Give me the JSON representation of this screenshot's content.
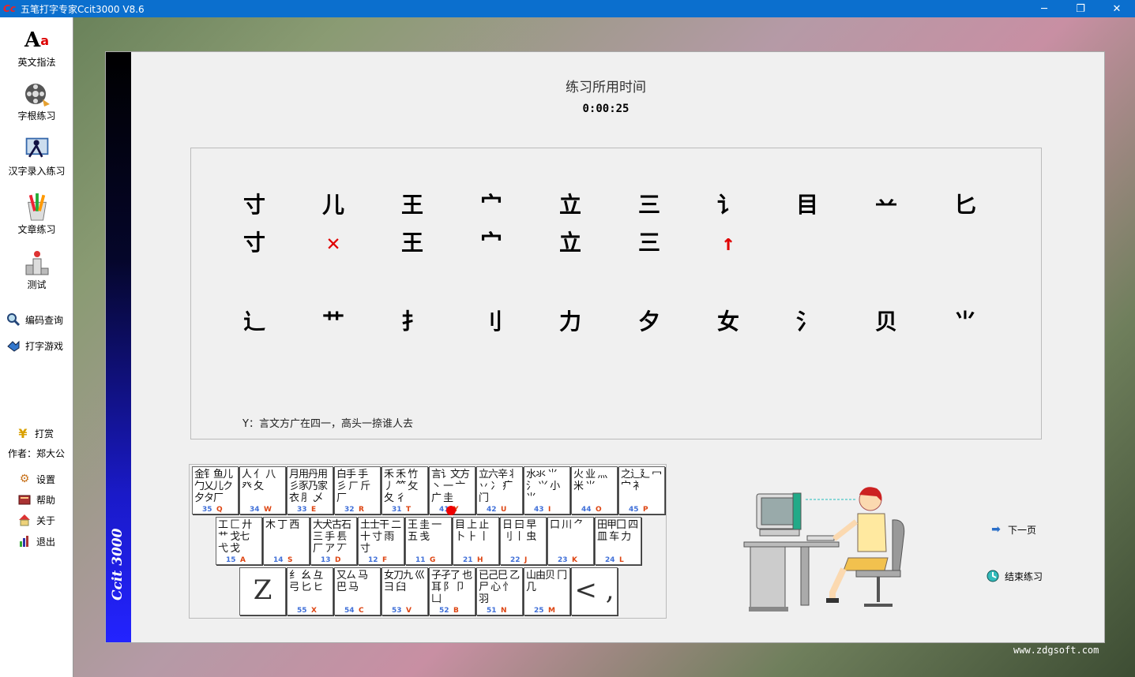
{
  "window": {
    "title": "五笔打字专家Ccit3000 V8.6",
    "logo_text": "Cc",
    "controls": {
      "minimize": "─",
      "restore": "❐",
      "close": "✕"
    }
  },
  "sidebar": {
    "items": [
      {
        "name": "english-fingering",
        "label": "英文指法",
        "icon": "Aa-icon"
      },
      {
        "name": "radical-practice",
        "label": "字根练习",
        "icon": "film-reel-icon"
      },
      {
        "name": "hanzi-input-practice",
        "label": "汉字录入练习",
        "icon": "typist-icon"
      },
      {
        "name": "article-practice",
        "label": "文章练习",
        "icon": "pencils-icon"
      },
      {
        "name": "test",
        "label": "测试",
        "icon": "podium-icon"
      }
    ],
    "tools": [
      {
        "name": "code-lookup",
        "label": "编码查询",
        "icon": "magnifier-icon"
      },
      {
        "name": "typing-games",
        "label": "打字游戏",
        "icon": "gamepad-icon"
      }
    ],
    "reward": {
      "label": "打赏",
      "icon": "yen-icon"
    },
    "author": "作者：郑大公",
    "menu": [
      {
        "name": "settings",
        "label": "设置",
        "icon": "gear-icon"
      },
      {
        "name": "help",
        "label": "帮助",
        "icon": "book-icon"
      },
      {
        "name": "about",
        "label": "关于",
        "icon": "house-icon"
      },
      {
        "name": "exit",
        "label": "退出",
        "icon": "exit-icon"
      }
    ]
  },
  "main": {
    "brand": "Ccit 3000",
    "time_label": "练习所用时间",
    "time_value": "0:00:25",
    "practice": {
      "row1": [
        "寸",
        "儿",
        "王",
        "宀",
        "立",
        "三",
        "讠",
        "目",
        "䒑",
        "匕"
      ],
      "row2": [
        "寸",
        "✕",
        "王",
        "宀",
        "立",
        "三",
        "↑"
      ],
      "row2_colors": [
        "#000",
        "#e00000",
        "#000",
        "#000",
        "#000",
        "#000",
        "#e00000"
      ],
      "row3": [
        "辶",
        "艹",
        "扌",
        "刂",
        "力",
        "夕",
        "女",
        "氵",
        "贝",
        "⺌"
      ],
      "hint": "Y：言文方广在四一，高头一捺谁人去"
    },
    "keyboard": {
      "row1": [
        {
          "chars": "金钅鱼儿勹乂儿ク夕タ厂",
          "num": "35",
          "letter": "Q"
        },
        {
          "chars": "人 亻 八 癶 夂",
          "num": "34",
          "letter": "W"
        },
        {
          "chars": "月用丹用彡豕乃家衣 ⺼ 乄",
          "num": "33",
          "letter": "E"
        },
        {
          "chars": "白手 手 彡 ㄏ 斤 厂",
          "num": "32",
          "letter": "R"
        },
        {
          "chars": "禾 禾 竹 丿 ⺮ 攵 夂 彳",
          "num": "31",
          "letter": "T"
        },
        {
          "chars": "言讠文方丶 一 亠 广 圭",
          "num": "41",
          "letter": "Y",
          "dot": true
        },
        {
          "chars": "立六辛丬 丷 冫 疒 门",
          "num": "42",
          "letter": "U"
        },
        {
          "chars": "水氺 ⺌ 氵 ⺍ 小 ⺌",
          "num": "43",
          "letter": "I"
        },
        {
          "chars": "火 业 灬 米 ⺌",
          "num": "44",
          "letter": "O"
        },
        {
          "chars": "之辶廴 冖 宀 衤",
          "num": "45",
          "letter": "P"
        }
      ],
      "row2": [
        {
          "chars": "工 匚 廾艹 戈七 弋 戈",
          "num": "15",
          "letter": "A"
        },
        {
          "chars": "木 丁 西",
          "num": "14",
          "letter": "S"
        },
        {
          "chars": "大犬古石 三 手 镸 厂 ア 丆",
          "num": "13",
          "letter": "D"
        },
        {
          "chars": "土士干 二 十 寸 雨 寸",
          "num": "12",
          "letter": "F"
        },
        {
          "chars": "王 圭 一 五 戋",
          "num": "11",
          "letter": "G"
        },
        {
          "chars": "目 上 止 卜 ⺊ 丨",
          "num": "21",
          "letter": "H"
        },
        {
          "chars": "日 曰 早 刂 丨 虫",
          "num": "22",
          "letter": "J"
        },
        {
          "chars": "口 川 ⺈",
          "num": "23",
          "letter": "K"
        },
        {
          "chars": "田甲囗 四 皿 车 力",
          "num": "24",
          "letter": "L"
        }
      ],
      "row3": [
        {
          "chars": "Z",
          "num": "",
          "letter": "",
          "big": true
        },
        {
          "chars": "纟 幺 彑 弓 匕 ヒ",
          "num": "55",
          "letter": "X"
        },
        {
          "chars": "又ㄙ 马 巴 马",
          "num": "54",
          "letter": "C"
        },
        {
          "chars": "女刀九 巛 彐 臼",
          "num": "53",
          "letter": "V"
        },
        {
          "chars": "子孑了 也 耳 阝 卩 凵",
          "num": "52",
          "letter": "B"
        },
        {
          "chars": "已己巳 乙 尸 心 忄 羽",
          "num": "51",
          "letter": "N"
        },
        {
          "chars": "山由贝 冂 几",
          "num": "25",
          "letter": "M"
        },
        {
          "chars": "< ,",
          "num": "",
          "letter": "",
          "big": true
        }
      ]
    },
    "next_page": "下一页",
    "end_practice": "结束练习"
  },
  "watermark": "www.zdgsoft.com"
}
